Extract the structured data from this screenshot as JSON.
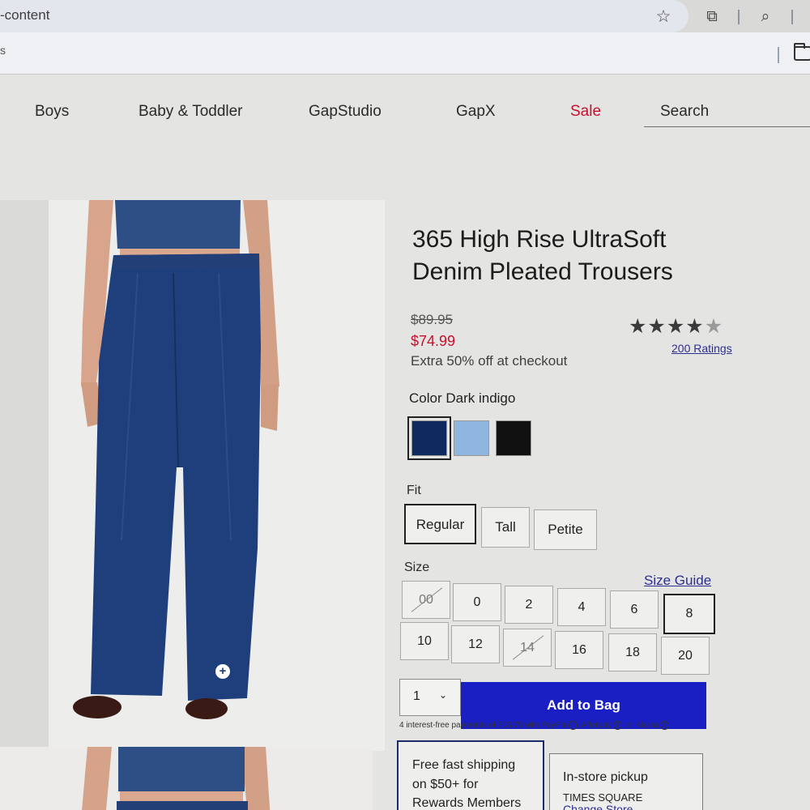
{
  "browser": {
    "url_fragment": "-content",
    "bookmark_fragment": "s",
    "icons": [
      "star-icon",
      "extension-icon",
      "tab-search-icon",
      "folder-icon"
    ]
  },
  "nav": {
    "links": [
      {
        "label": "Boys"
      },
      {
        "label": "Baby & Toddler"
      },
      {
        "label": "GapStudio"
      },
      {
        "label": "GapX"
      },
      {
        "label": "Sale"
      }
    ],
    "search_label": "Search",
    "sale_color": "#c8102e"
  },
  "product": {
    "title_line1": "365 High Rise UltraSoft",
    "title_line2": "Denim Pleated Trousers",
    "price_original": "$89.95",
    "price_sale": "$74.99",
    "promo": "Extra 50% off at checkout",
    "rating": 4.5,
    "ratings_link": "200 Ratings",
    "color_label": "Color Dark indigo",
    "colors": [
      {
        "name": "dark-indigo",
        "hex": "#0f2a5e",
        "selected": true
      },
      {
        "name": "light-wash",
        "hex": "#8fb6df",
        "selected": false
      },
      {
        "name": "black",
        "hex": "#111111",
        "selected": false
      }
    ],
    "fit_label": "Fit",
    "fits": [
      {
        "label": "Regular",
        "selected": true
      },
      {
        "label": "Tall",
        "selected": false
      },
      {
        "label": "Petite",
        "selected": false
      }
    ],
    "size_label": "Size",
    "size_guide": "Size Guide",
    "sizes": [
      {
        "label": "00",
        "state": "unavailable"
      },
      {
        "label": "0",
        "state": "available"
      },
      {
        "label": "2",
        "state": "available"
      },
      {
        "label": "4",
        "state": "available"
      },
      {
        "label": "6",
        "state": "available"
      },
      {
        "label": "8",
        "state": "selected"
      },
      {
        "label": "10",
        "state": "available"
      },
      {
        "label": "12",
        "state": "available"
      },
      {
        "label": "14",
        "state": "unavailable"
      },
      {
        "label": "16",
        "state": "available"
      },
      {
        "label": "18",
        "state": "available"
      },
      {
        "label": "20",
        "state": "available"
      }
    ],
    "quantity": "1",
    "add_to_bag": "Add to Bag",
    "installments": {
      "text": "4 interest-free payments of $18.75 with",
      "paypal": "PayPal",
      "afterpay": "Afterpay",
      "or": "or",
      "klarna": "Klarna"
    },
    "shipping": {
      "line1": "Free fast shipping",
      "line2": "on $50+ for",
      "line3": "Rewards Members"
    },
    "pickup": {
      "title": "In-store pickup",
      "store": "TIMES SQUARE",
      "change": "Change Store"
    },
    "accent_blue": "#1a1fc4"
  }
}
